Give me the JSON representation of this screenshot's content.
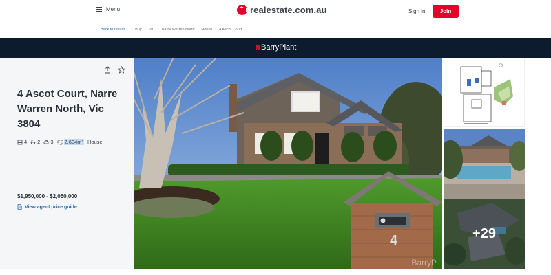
{
  "header": {
    "menu_label": "Menu",
    "logo_text": "realestate.com.au",
    "signin_label": "Sign in",
    "join_label": "Join",
    "brand_color": "#e4002b"
  },
  "breadcrumb": {
    "back_label": "← Back to results",
    "items": [
      "Buy",
      "VIC",
      "Narre Warren North",
      "House",
      "4 Ascot Court"
    ]
  },
  "agency": {
    "name": "BarryPlant",
    "band_color": "#0d1b2e"
  },
  "listing": {
    "address": "4 Ascot Court, Narre Warren North, Vic 3804",
    "features": {
      "bedrooms": "4",
      "bathrooms": "2",
      "parking": "3",
      "land_size": "2,634m²",
      "property_type": "House"
    },
    "price": "$1,950,000 - $2,050,000",
    "price_guide_label": "View agent price guide",
    "icons": [
      "share-icon",
      "star-icon",
      "bed-icon",
      "bath-icon",
      "car-icon",
      "land-icon",
      "price-guide-icon"
    ]
  },
  "gallery": {
    "watermark": "BarryP",
    "more_photos_label": "+29"
  }
}
